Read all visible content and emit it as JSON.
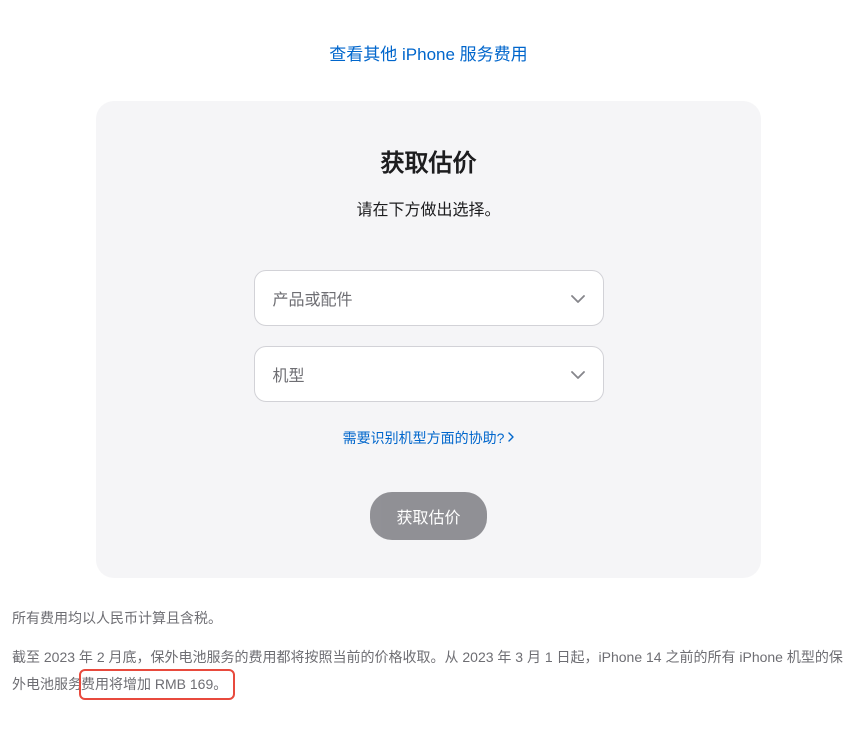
{
  "topLink": "查看其他 iPhone 服务费用",
  "card": {
    "title": "获取估价",
    "subtitle": "请在下方做出选择。",
    "select1": {
      "placeholder": "产品或配件"
    },
    "select2": {
      "placeholder": "机型"
    },
    "helpLink": "需要识别机型方面的协助?",
    "submit": "获取估价"
  },
  "notes": {
    "line1": "所有费用均以人民币计算且含税。",
    "line2_part1": "截至 2023 年 2 月底，保外电池服务的费用都将按照当前的价格收取。从 2023 年 3 月 1 日起，iPhone 14 之前的所有 iPhone 机型的保外电池服务",
    "line2_highlight": "费用将增加 RMB 169。"
  }
}
